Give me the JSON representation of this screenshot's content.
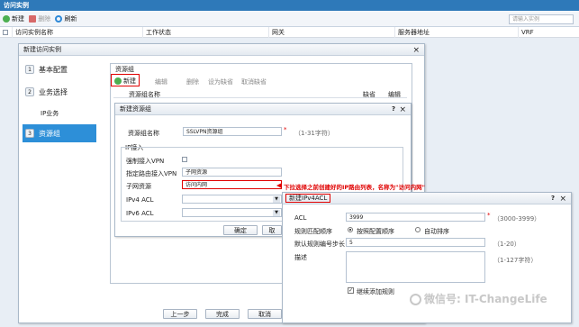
{
  "window": {
    "title": "访问实例"
  },
  "toolbar": {
    "new_label": "新建",
    "delete_label": "删除",
    "refresh_label": "刷新",
    "search_placeholder": "请输入实例"
  },
  "grid": {
    "columns": [
      "访问实例名称",
      "工作状态",
      "网关",
      "服务器地址",
      "VRF"
    ]
  },
  "wizard": {
    "title": "新建访问实例",
    "close": "×",
    "steps": [
      {
        "num": "1",
        "label": "基本配置"
      },
      {
        "num": "2",
        "label": "业务选择"
      },
      {
        "num": "",
        "label": "IP业务"
      },
      {
        "num": "3",
        "label": "资源组"
      }
    ],
    "group_title": "资源组",
    "actions": [
      "新建",
      "编辑",
      "删除",
      "设为缺省",
      "取消缺省"
    ],
    "group_columns": [
      "资源组名称",
      "缺省",
      "编辑"
    ],
    "buttons": [
      "上一步",
      "完成",
      "取消"
    ]
  },
  "resource_dialog": {
    "title": "新建资源组",
    "help": "?",
    "close": "×",
    "name_label": "资源组名称",
    "name_value": "SSLVPN资源组",
    "required_mark": "*",
    "name_hint": "（1-31字符）",
    "section": "IP接入",
    "force_vpn_label": "强制接入VPN",
    "route_vpn_label": "指定路由接入VPN",
    "route_value": "子网资源",
    "subnet_label": "子网资源",
    "subnet_value": "访问内网",
    "ipv4_label": "IPv4 ACL",
    "ipv6_label": "IPv6 ACL",
    "ok": "确定",
    "cancel": "取"
  },
  "annotation": {
    "text": "下拉选择之前创建好的IP路由列表，名称为\"访问内网\""
  },
  "acl_dialog": {
    "title": "新建IPv4ACL",
    "help": "?",
    "close": "×",
    "acl_label": "ACL",
    "acl_value": "3999",
    "acl_hint": "（3000-3999）",
    "required_mark": "*",
    "order_label": "规则匹配顺序",
    "order_config": "按照配置顺序",
    "order_auto": "自动排序",
    "step_label": "默认规则编号步长",
    "step_value": "5",
    "step_hint": "（1-20）",
    "desc_label": "描述",
    "desc_hint": "（1-127字符）",
    "continue_label": "继续添加规则"
  },
  "watermark": {
    "text": "微信号: IT-ChangeLife"
  },
  "colors": {
    "title_blue": "#2e79b9",
    "active_step": "#2d8fd8",
    "highlight": "#e00000",
    "annotation_red": "#e00000"
  }
}
